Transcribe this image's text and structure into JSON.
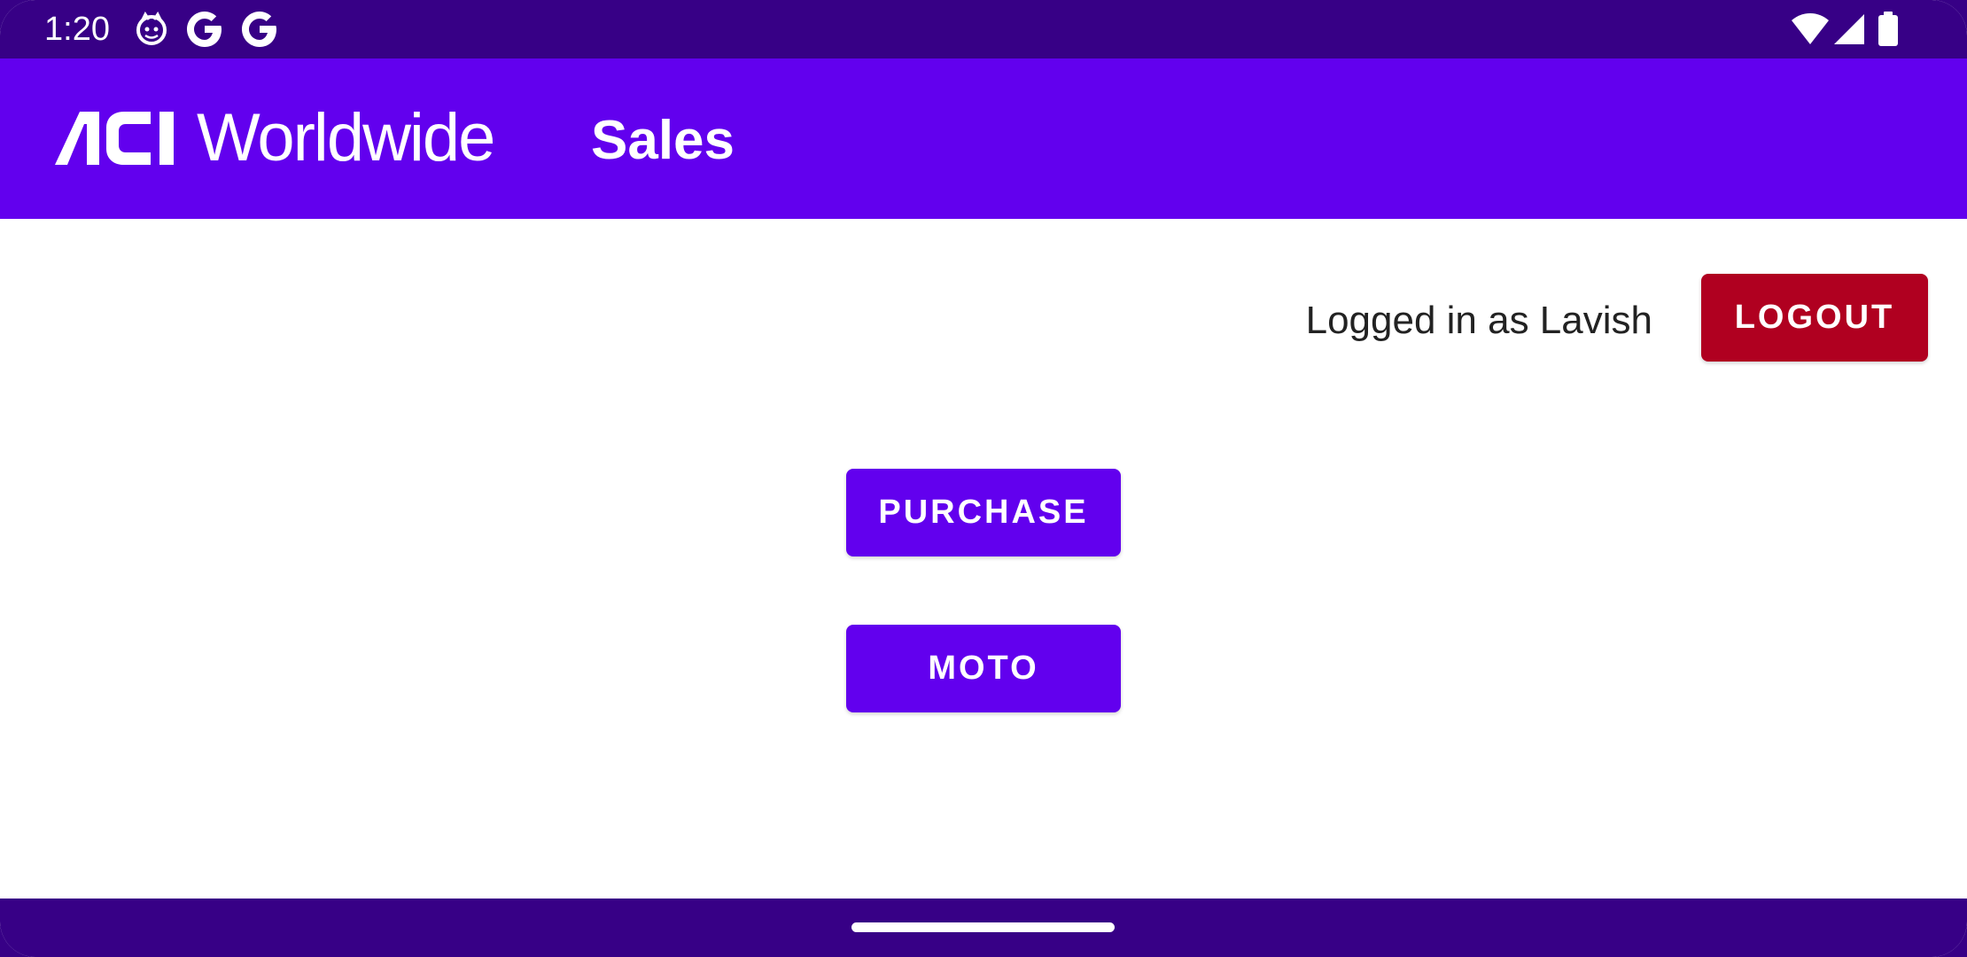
{
  "status_bar": {
    "time": "1:20",
    "left_icons": [
      "cat-face-icon",
      "google-g-icon",
      "google-g-icon"
    ],
    "right_icons": [
      "wifi-icon",
      "cell-signal-icon",
      "battery-icon"
    ]
  },
  "app_bar": {
    "logo_text": "Worldwide",
    "title": "Sales"
  },
  "session": {
    "logged_in_text": "Logged in as Lavish",
    "logout_label": "LOGOUT"
  },
  "actions": {
    "purchase_label": "PURCHASE",
    "moto_label": "MOTO"
  },
  "colors": {
    "status_bar": "#370086",
    "app_bar": "#6200ee",
    "primary_button": "#6200ee",
    "logout_button": "#b00020"
  }
}
